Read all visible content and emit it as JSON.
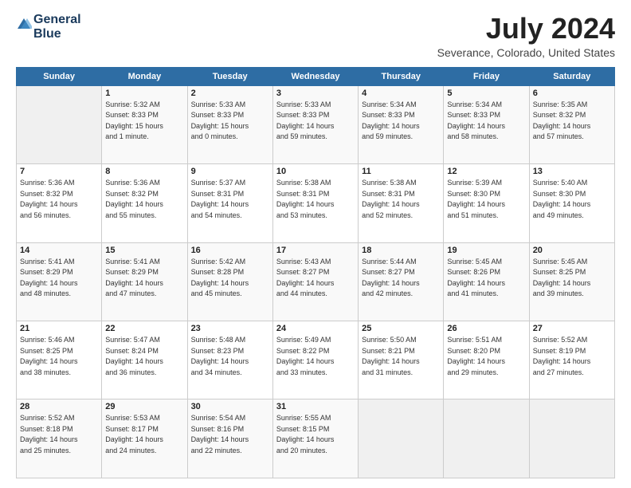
{
  "header": {
    "logo_line1": "General",
    "logo_line2": "Blue",
    "month": "July 2024",
    "location": "Severance, Colorado, United States"
  },
  "weekdays": [
    "Sunday",
    "Monday",
    "Tuesday",
    "Wednesday",
    "Thursday",
    "Friday",
    "Saturday"
  ],
  "weeks": [
    [
      {
        "day": "",
        "info": ""
      },
      {
        "day": "1",
        "info": "Sunrise: 5:32 AM\nSunset: 8:33 PM\nDaylight: 15 hours\nand 1 minute."
      },
      {
        "day": "2",
        "info": "Sunrise: 5:33 AM\nSunset: 8:33 PM\nDaylight: 15 hours\nand 0 minutes."
      },
      {
        "day": "3",
        "info": "Sunrise: 5:33 AM\nSunset: 8:33 PM\nDaylight: 14 hours\nand 59 minutes."
      },
      {
        "day": "4",
        "info": "Sunrise: 5:34 AM\nSunset: 8:33 PM\nDaylight: 14 hours\nand 59 minutes."
      },
      {
        "day": "5",
        "info": "Sunrise: 5:34 AM\nSunset: 8:33 PM\nDaylight: 14 hours\nand 58 minutes."
      },
      {
        "day": "6",
        "info": "Sunrise: 5:35 AM\nSunset: 8:32 PM\nDaylight: 14 hours\nand 57 minutes."
      }
    ],
    [
      {
        "day": "7",
        "info": "Sunrise: 5:36 AM\nSunset: 8:32 PM\nDaylight: 14 hours\nand 56 minutes."
      },
      {
        "day": "8",
        "info": "Sunrise: 5:36 AM\nSunset: 8:32 PM\nDaylight: 14 hours\nand 55 minutes."
      },
      {
        "day": "9",
        "info": "Sunrise: 5:37 AM\nSunset: 8:31 PM\nDaylight: 14 hours\nand 54 minutes."
      },
      {
        "day": "10",
        "info": "Sunrise: 5:38 AM\nSunset: 8:31 PM\nDaylight: 14 hours\nand 53 minutes."
      },
      {
        "day": "11",
        "info": "Sunrise: 5:38 AM\nSunset: 8:31 PM\nDaylight: 14 hours\nand 52 minutes."
      },
      {
        "day": "12",
        "info": "Sunrise: 5:39 AM\nSunset: 8:30 PM\nDaylight: 14 hours\nand 51 minutes."
      },
      {
        "day": "13",
        "info": "Sunrise: 5:40 AM\nSunset: 8:30 PM\nDaylight: 14 hours\nand 49 minutes."
      }
    ],
    [
      {
        "day": "14",
        "info": "Sunrise: 5:41 AM\nSunset: 8:29 PM\nDaylight: 14 hours\nand 48 minutes."
      },
      {
        "day": "15",
        "info": "Sunrise: 5:41 AM\nSunset: 8:29 PM\nDaylight: 14 hours\nand 47 minutes."
      },
      {
        "day": "16",
        "info": "Sunrise: 5:42 AM\nSunset: 8:28 PM\nDaylight: 14 hours\nand 45 minutes."
      },
      {
        "day": "17",
        "info": "Sunrise: 5:43 AM\nSunset: 8:27 PM\nDaylight: 14 hours\nand 44 minutes."
      },
      {
        "day": "18",
        "info": "Sunrise: 5:44 AM\nSunset: 8:27 PM\nDaylight: 14 hours\nand 42 minutes."
      },
      {
        "day": "19",
        "info": "Sunrise: 5:45 AM\nSunset: 8:26 PM\nDaylight: 14 hours\nand 41 minutes."
      },
      {
        "day": "20",
        "info": "Sunrise: 5:45 AM\nSunset: 8:25 PM\nDaylight: 14 hours\nand 39 minutes."
      }
    ],
    [
      {
        "day": "21",
        "info": "Sunrise: 5:46 AM\nSunset: 8:25 PM\nDaylight: 14 hours\nand 38 minutes."
      },
      {
        "day": "22",
        "info": "Sunrise: 5:47 AM\nSunset: 8:24 PM\nDaylight: 14 hours\nand 36 minutes."
      },
      {
        "day": "23",
        "info": "Sunrise: 5:48 AM\nSunset: 8:23 PM\nDaylight: 14 hours\nand 34 minutes."
      },
      {
        "day": "24",
        "info": "Sunrise: 5:49 AM\nSunset: 8:22 PM\nDaylight: 14 hours\nand 33 minutes."
      },
      {
        "day": "25",
        "info": "Sunrise: 5:50 AM\nSunset: 8:21 PM\nDaylight: 14 hours\nand 31 minutes."
      },
      {
        "day": "26",
        "info": "Sunrise: 5:51 AM\nSunset: 8:20 PM\nDaylight: 14 hours\nand 29 minutes."
      },
      {
        "day": "27",
        "info": "Sunrise: 5:52 AM\nSunset: 8:19 PM\nDaylight: 14 hours\nand 27 minutes."
      }
    ],
    [
      {
        "day": "28",
        "info": "Sunrise: 5:52 AM\nSunset: 8:18 PM\nDaylight: 14 hours\nand 25 minutes."
      },
      {
        "day": "29",
        "info": "Sunrise: 5:53 AM\nSunset: 8:17 PM\nDaylight: 14 hours\nand 24 minutes."
      },
      {
        "day": "30",
        "info": "Sunrise: 5:54 AM\nSunset: 8:16 PM\nDaylight: 14 hours\nand 22 minutes."
      },
      {
        "day": "31",
        "info": "Sunrise: 5:55 AM\nSunset: 8:15 PM\nDaylight: 14 hours\nand 20 minutes."
      },
      {
        "day": "",
        "info": ""
      },
      {
        "day": "",
        "info": ""
      },
      {
        "day": "",
        "info": ""
      }
    ]
  ]
}
